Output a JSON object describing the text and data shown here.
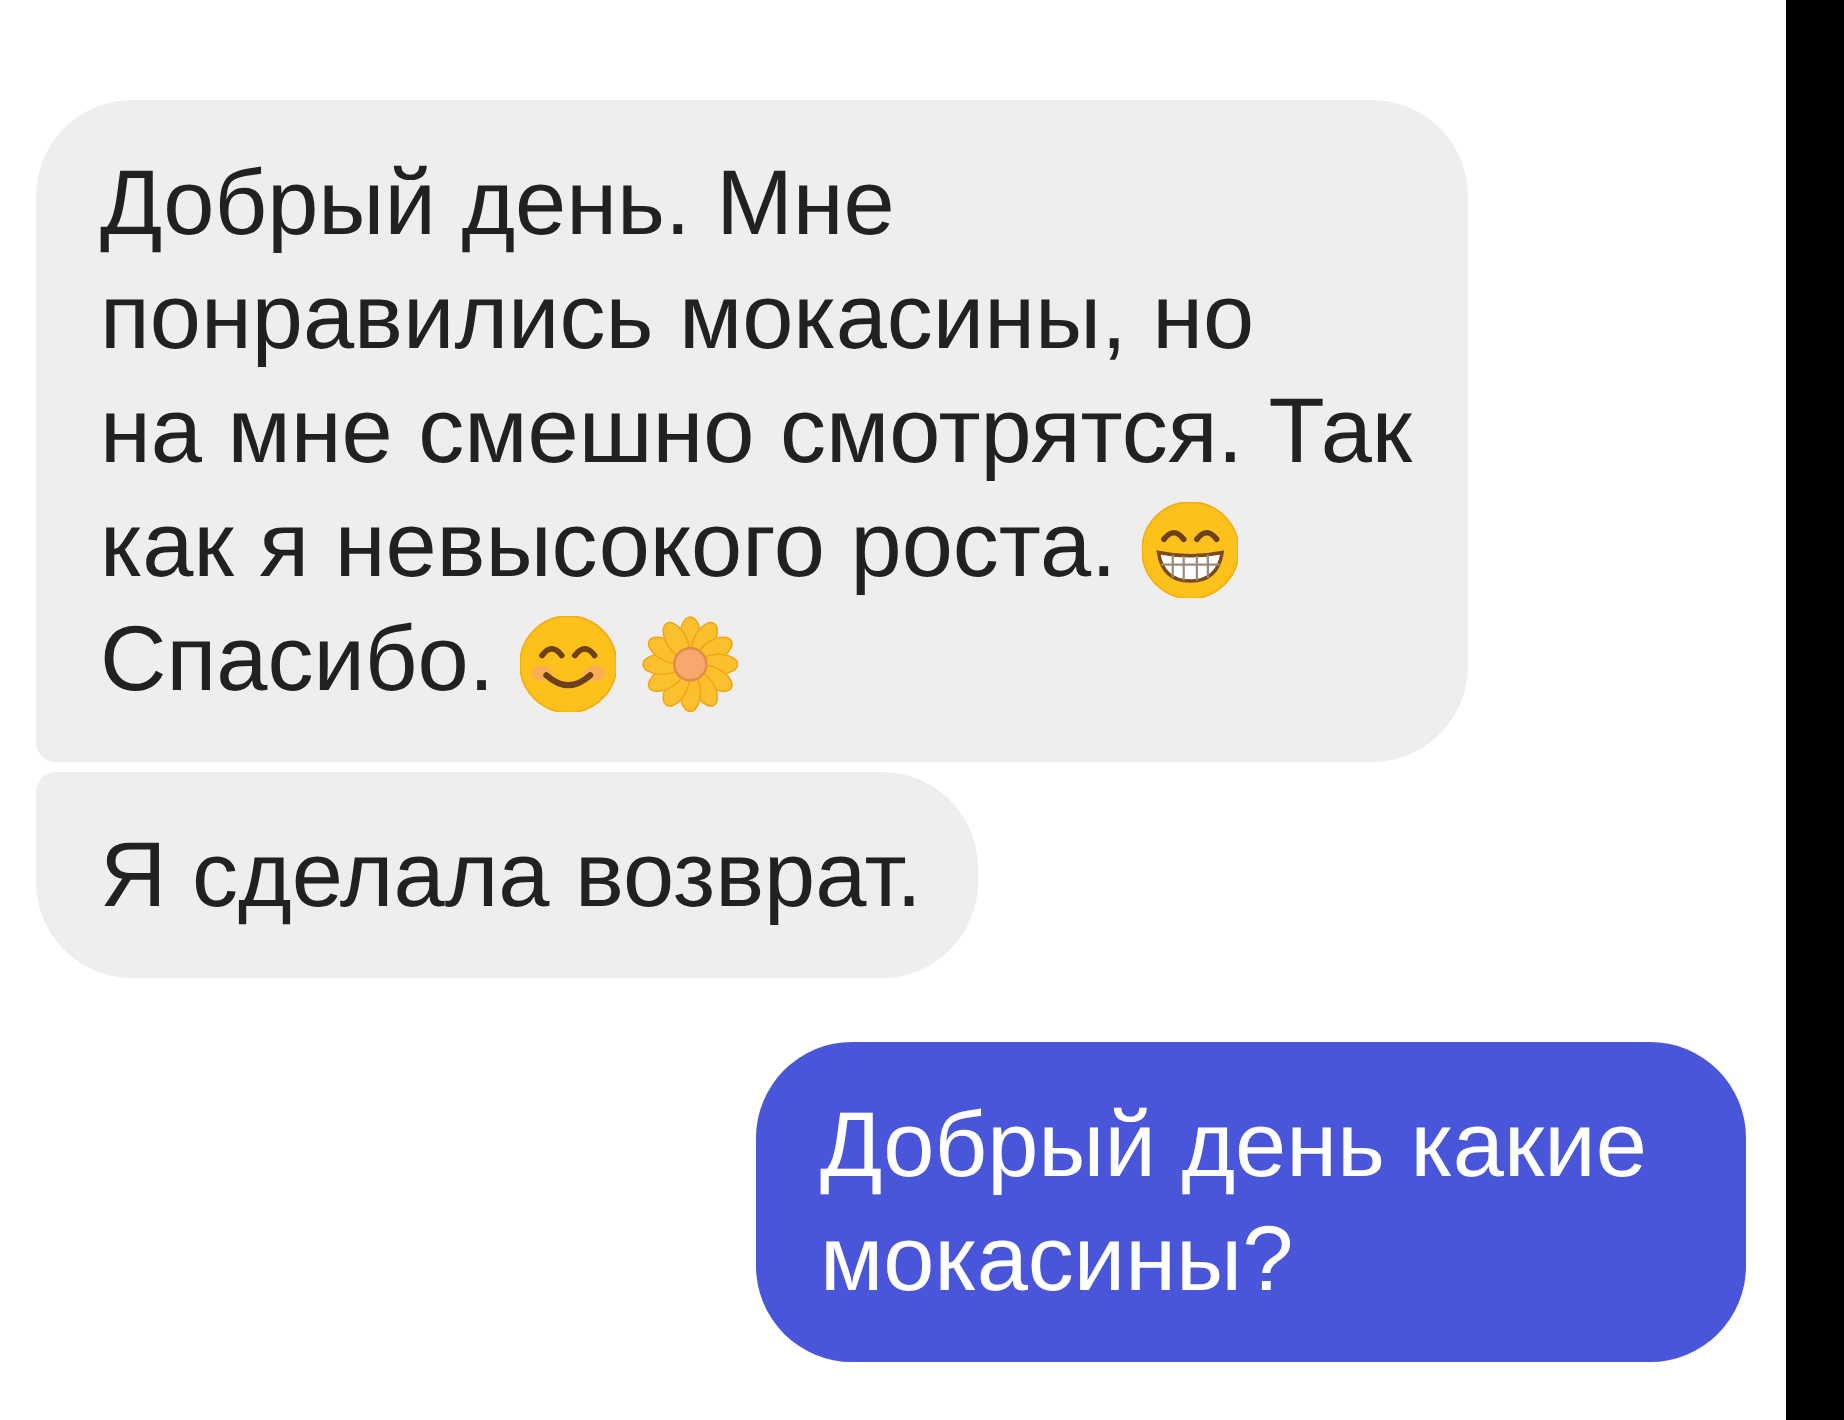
{
  "messages": [
    {
      "kind": "incoming",
      "rows": [
        {
          "parts": [
            {
              "kind": "text",
              "text": "Добрый день. Мне\nпонравились мокасины, но\nна мне смешно смотрятся. Так"
            }
          ]
        },
        {
          "parts": [
            {
              "kind": "text",
              "text": "как я невысокого роста."
            },
            {
              "kind": "grin"
            }
          ]
        },
        {
          "parts": [
            {
              "kind": "text",
              "text": "Спасибо."
            },
            {
              "kind": "smile"
            },
            {
              "kind": "flower"
            }
          ]
        }
      ]
    },
    {
      "kind": "incoming",
      "rows": [
        {
          "parts": [
            {
              "kind": "text",
              "text": "Я сделала возврат."
            }
          ]
        }
      ]
    },
    {
      "kind": "outgoing",
      "rows": [
        {
          "parts": [
            {
              "kind": "text",
              "text": "Добрый день какие мокасины?"
            }
          ]
        }
      ]
    }
  ]
}
